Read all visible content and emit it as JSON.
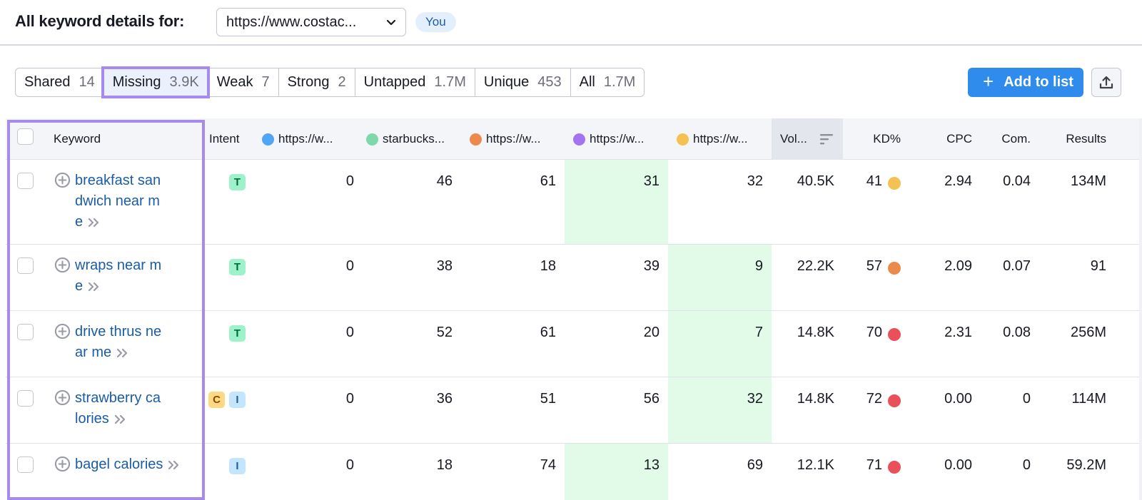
{
  "header": {
    "title": "All keyword details for:",
    "domain_selected": "https://www.costac...",
    "you_badge": "You"
  },
  "tabs": [
    {
      "label": "Shared",
      "count": "14",
      "active": false
    },
    {
      "label": "Missing",
      "count": "3.9K",
      "active": true
    },
    {
      "label": "Weak",
      "count": "7",
      "active": false
    },
    {
      "label": "Strong",
      "count": "2",
      "active": false
    },
    {
      "label": "Untapped",
      "count": "1.7M",
      "active": false
    },
    {
      "label": "Unique",
      "count": "453",
      "active": false
    },
    {
      "label": "All",
      "count": "1.7M",
      "active": false
    }
  ],
  "toolbar": {
    "add_to_list_label": "Add to list",
    "add_icon": "plus-icon",
    "export_icon": "export-icon"
  },
  "columns": {
    "keyword": "Keyword",
    "intent": "Intent",
    "domains": [
      {
        "label": "https://w...",
        "color": "#4ea6f5"
      },
      {
        "label": "starbucks...",
        "color": "#7dd9a8"
      },
      {
        "label": "https://w...",
        "color": "#ec8a4d"
      },
      {
        "label": "https://w...",
        "color": "#a374f0"
      },
      {
        "label": "https://w...",
        "color": "#f4c153"
      }
    ],
    "volume": "Vol...",
    "kd": "KD%",
    "cpc": "CPC",
    "com": "Com.",
    "results": "Results"
  },
  "colors": {
    "kd_easy": "#f4c153",
    "kd_medium": "#ec8a4d",
    "kd_hard": "#e9505a",
    "highlight": "#e1fbe8",
    "selection_outline": "#a78bec",
    "accent": "#2f8ced"
  },
  "rows": [
    {
      "keyword": "breakfast sandwich near me",
      "intent": [
        "T"
      ],
      "positions": [
        "0",
        "46",
        "61",
        "31",
        "32"
      ],
      "highlight_col": 3,
      "volume": "40.5K",
      "kd": "41",
      "kd_level": "easy",
      "cpc": "2.94",
      "com": "0.04",
      "results": "134M"
    },
    {
      "keyword": "wraps near me",
      "intent": [
        "T"
      ],
      "positions": [
        "0",
        "38",
        "18",
        "39",
        "9"
      ],
      "highlight_col": 4,
      "volume": "22.2K",
      "kd": "57",
      "kd_level": "medium",
      "cpc": "2.09",
      "com": "0.07",
      "results": "91"
    },
    {
      "keyword": "drive thrus near me",
      "intent": [
        "T"
      ],
      "positions": [
        "0",
        "52",
        "61",
        "20",
        "7"
      ],
      "highlight_col": 4,
      "volume": "14.8K",
      "kd": "70",
      "kd_level": "hard",
      "cpc": "2.31",
      "com": "0.08",
      "results": "256M"
    },
    {
      "keyword": "strawberry calories",
      "intent": [
        "C",
        "I"
      ],
      "positions": [
        "0",
        "36",
        "51",
        "56",
        "32"
      ],
      "highlight_col": 4,
      "volume": "14.8K",
      "kd": "72",
      "kd_level": "hard",
      "cpc": "0.00",
      "com": "0",
      "results": "114M"
    },
    {
      "keyword": "bagel calories",
      "intent": [
        "I"
      ],
      "positions": [
        "0",
        "18",
        "74",
        "13",
        "69"
      ],
      "highlight_col": 3,
      "volume": "12.1K",
      "kd": "71",
      "kd_level": "hard",
      "cpc": "0.00",
      "com": "0",
      "results": "59.2M"
    }
  ]
}
